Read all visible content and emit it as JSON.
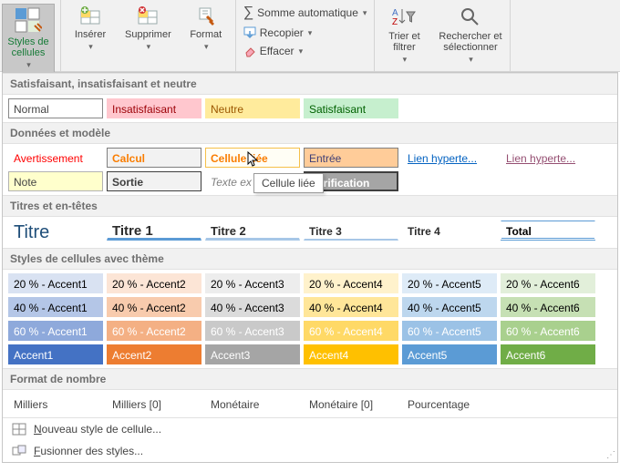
{
  "ribbon": {
    "styles_label": "Styles de\ncellules",
    "insert": "Insérer",
    "delete": "Supprimer",
    "format": "Format",
    "autosum": "Somme automatique",
    "fill": "Recopier",
    "clear": "Effacer",
    "sortfilter": "Trier et\nfiltrer",
    "findselect": "Rechercher et\nsélectionner"
  },
  "sections": {
    "s1": "Satisfaisant, insatisfaisant et neutre",
    "s2": "Données et modèle",
    "s3": "Titres et en-têtes",
    "s4": "Styles de cellules avec thème",
    "s5": "Format de nombre"
  },
  "good_bad": {
    "normal": "Normal",
    "bad": "Insatisfaisant",
    "neutral": "Neutre",
    "good": "Satisfaisant"
  },
  "data_model": {
    "warn": "Avertissement",
    "calc": "Calcul",
    "linked": "Cellule liée",
    "input": "Entrée",
    "hyper1": "Lien hyperte...",
    "hyper2": "Lien hyperte...",
    "note": "Note",
    "output": "Sortie",
    "explain": "Texte ex",
    "check": "Vérification"
  },
  "titles": {
    "t": "Titre",
    "t1": "Titre 1",
    "t2": "Titre 2",
    "t3": "Titre 3",
    "t4": "Titre 4",
    "total": "Total"
  },
  "accents": {
    "p20": [
      "20 % - Accent1",
      "20 % - Accent2",
      "20 % - Accent3",
      "20 % - Accent4",
      "20 % - Accent5",
      "20 % - Accent6"
    ],
    "p40": [
      "40 % - Accent1",
      "40 % - Accent2",
      "40 % - Accent3",
      "40 % - Accent4",
      "40 % - Accent5",
      "40 % - Accent6"
    ],
    "p60": [
      "60 % - Accent1",
      "60 % - Accent2",
      "60 % - Accent3",
      "60 % - Accent4",
      "60 % - Accent5",
      "60 % - Accent6"
    ],
    "full": [
      "Accent1",
      "Accent2",
      "Accent3",
      "Accent4",
      "Accent5",
      "Accent6"
    ]
  },
  "number": {
    "thousands": "Milliers",
    "thousands0": "Milliers [0]",
    "currency": "Monétaire",
    "currency0": "Monétaire [0]",
    "percent": "Pourcentage"
  },
  "menu": {
    "new": "Nouveau style de cellule...",
    "merge": "Fusionner des styles..."
  },
  "tooltip": "Cellule liée",
  "colors": {
    "bad_bg": "#ffc7ce",
    "bad_fg": "#9c0006",
    "neutral_bg": "#ffeb9c",
    "neutral_fg": "#9c5700",
    "good_bg": "#c6efce",
    "good_fg": "#006100",
    "calc_bg": "#f2f2f2",
    "calc_fg": "#fa7d00",
    "calc_bd": "#7f7f7f",
    "linked_bg": "#ffedb3",
    "linked_fg": "#fa7d00",
    "linked_bd": "#f5c04a",
    "input_bg": "#ffcc99",
    "input_fg": "#3f3f76",
    "input_bd": "#7f7f7f",
    "link_fg": "#0563c1",
    "flink_fg": "#954f72",
    "note_bg": "#ffffcc",
    "note_bd": "#b2b2b2",
    "output_bg": "#f2f2f2",
    "output_fg": "#3f3f3f",
    "output_bd": "#3f3f3f",
    "explain_fg": "#7f7f7f",
    "check_bg": "#a5a5a5",
    "check_fg": "#ffffff",
    "check_bd": "#3f3f3f",
    "titre_fg": "#1f4e79",
    "h_line": "#5b9bd5",
    "a20": [
      "#d9e2f2",
      "#fce5d6",
      "#ededed",
      "#fff2cc",
      "#deebf7",
      "#e2efda"
    ],
    "a40": [
      "#b4c6e7",
      "#f8cbad",
      "#dbdbdb",
      "#ffe699",
      "#bdd7ee",
      "#c6e0b4"
    ],
    "a60": [
      "#8ea9db",
      "#f4b084",
      "#c9c9c9",
      "#ffd966",
      "#9bc2e6",
      "#a9d08e"
    ],
    "af": [
      "#4472c4",
      "#ed7d31",
      "#a5a5a5",
      "#ffc000",
      "#5b9bd5",
      "#70ad47"
    ]
  }
}
